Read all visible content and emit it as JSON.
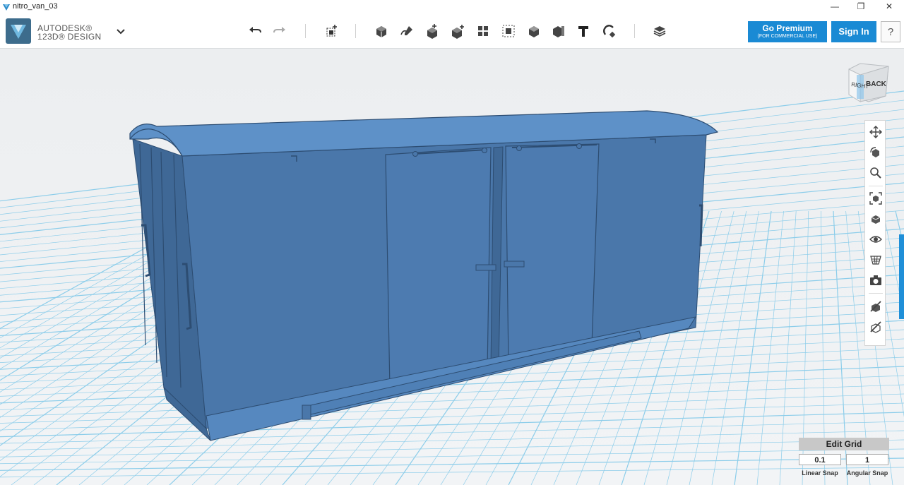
{
  "window": {
    "title": "nitro_van_03",
    "minimize": "—",
    "restore": "❐",
    "close": "✕"
  },
  "brand": {
    "line1": "AUTODESK®",
    "line2": "123D® DESIGN"
  },
  "toolbar": {
    "tools": [
      {
        "name": "undo-icon"
      },
      {
        "name": "redo-icon"
      },
      {
        "name": "transform-icon"
      },
      {
        "name": "primitives-icon"
      },
      {
        "name": "sketch-icon"
      },
      {
        "name": "construct-icon"
      },
      {
        "name": "modify-icon"
      },
      {
        "name": "pattern-icon"
      },
      {
        "name": "grouping-icon"
      },
      {
        "name": "combine-icon"
      },
      {
        "name": "measure-icon"
      },
      {
        "name": "text-icon"
      },
      {
        "name": "snap-icon"
      },
      {
        "name": "material-icon"
      }
    ],
    "premium_label": "Go Premium",
    "premium_sub": "(FOR COMMERCIAL USE)",
    "signin_label": "Sign In",
    "help_label": "?"
  },
  "viewcube": {
    "face_left": "RIGHT",
    "face_front": "BACK"
  },
  "nav": [
    {
      "name": "pan-icon"
    },
    {
      "name": "orbit-icon"
    },
    {
      "name": "zoom-icon"
    },
    {
      "name": "fit-icon"
    },
    {
      "name": "view-icon"
    },
    {
      "name": "visibility-icon"
    },
    {
      "name": "material-display-icon"
    },
    {
      "name": "camera-icon"
    },
    {
      "name": "hide-icon"
    },
    {
      "name": "show-icon"
    }
  ],
  "grid": {
    "edit_label": "Edit Grid",
    "linear_value": "0.1",
    "angular_value": "1",
    "linear_label": "Linear Snap",
    "angular_label": "Angular Snap"
  },
  "colors": {
    "accent": "#1a8ad4",
    "model": "#4a77aa",
    "model_top": "#5e91c8",
    "grid_line": "#8ccdea"
  }
}
